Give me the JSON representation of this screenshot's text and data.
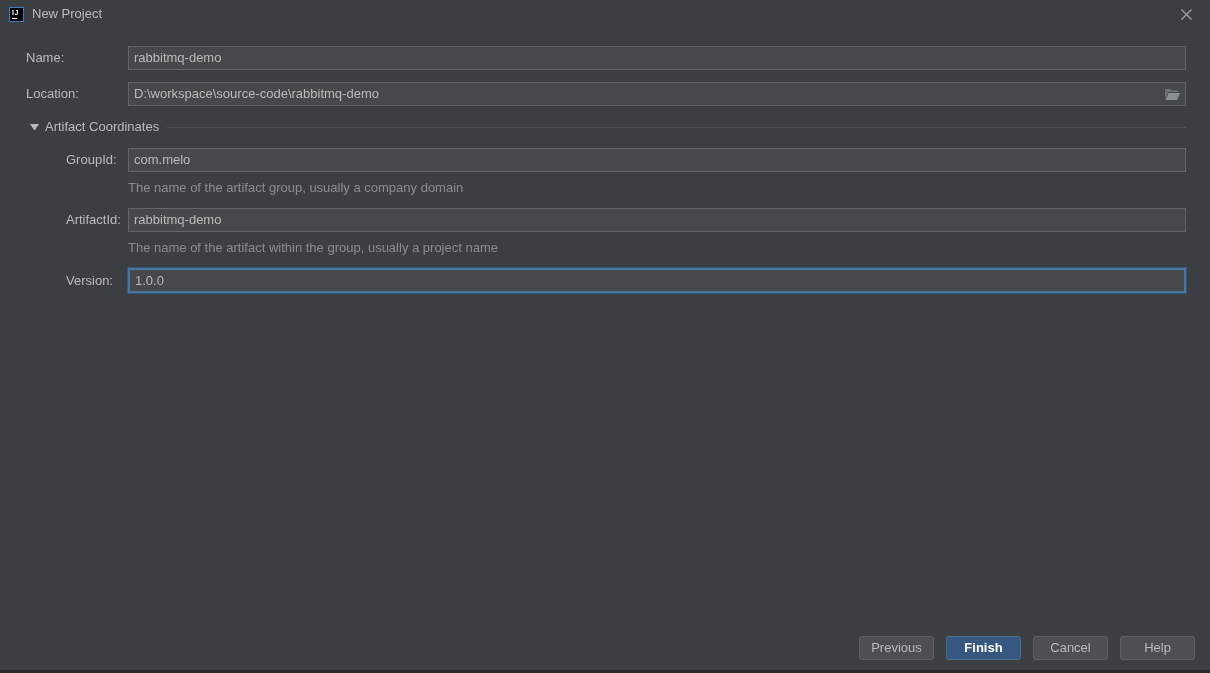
{
  "window": {
    "logo": "IJ",
    "title": "New Project"
  },
  "fields": [
    {
      "label": "Name:",
      "value": "rabbitmq-demo",
      "kind": "text",
      "focused": false
    },
    {
      "label": "Location:",
      "value": "D:\\workspace\\source-code\\rabbitmq-demo",
      "kind": "browse",
      "focused": false
    }
  ],
  "artifact_section": {
    "title": "Artifact Coordinates",
    "expanded": true,
    "fields": [
      {
        "label": "GroupId:",
        "value": "com.melo",
        "hint": "The name of the artifact group, usually a company domain",
        "kind": "text",
        "focused": false
      },
      {
        "label": "ArtifactId:",
        "value": "rabbitmq-demo",
        "hint": "The name of the artifact within the group, usually a project name",
        "kind": "text",
        "focused": false
      },
      {
        "label": "Version:",
        "value": "1.0.0",
        "kind": "text",
        "focused": true
      }
    ]
  },
  "buttons": [
    {
      "label": "Previous",
      "kind": "default"
    },
    {
      "label": "Finish",
      "kind": "primary"
    },
    {
      "label": "Cancel",
      "kind": "default"
    },
    {
      "label": "Help",
      "kind": "default"
    }
  ]
}
